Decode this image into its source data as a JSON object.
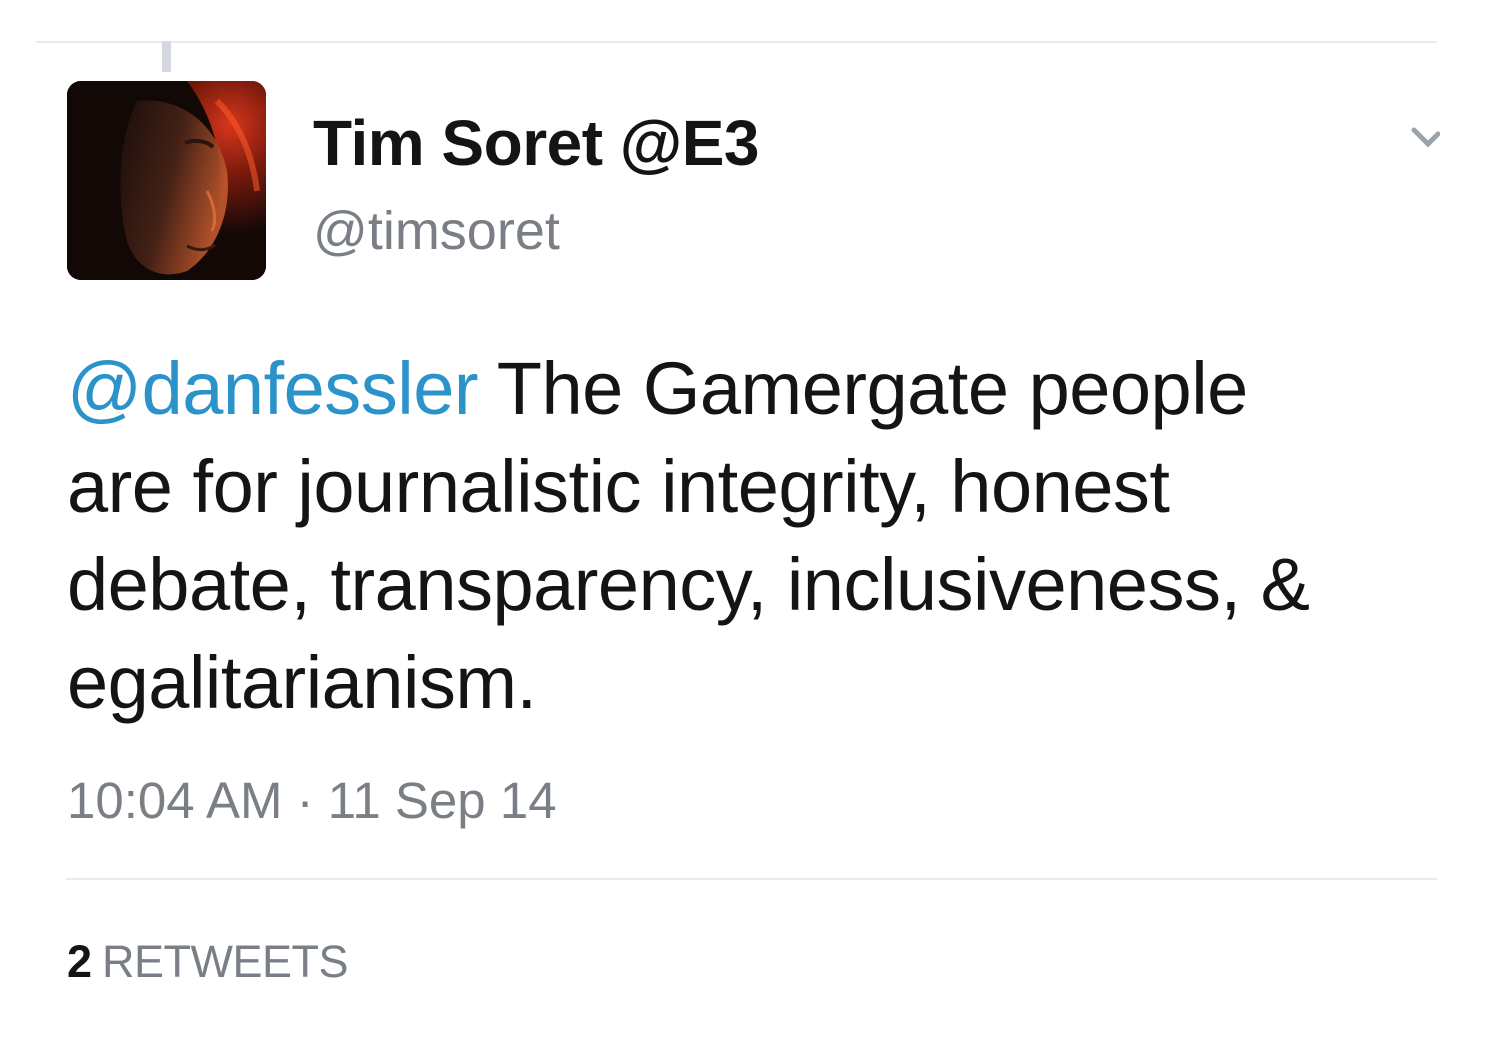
{
  "tweet": {
    "author": {
      "display_name": "Tim Soret @E3",
      "handle": "@timsoret"
    },
    "text": {
      "mention": "@danfessler",
      "line1_rest": " The Gamergate people",
      "line2": "are for journalistic integrity, honest",
      "line3": "debate, transparency, inclusiveness, &",
      "line4": "egalitarianism."
    },
    "timestamp": "10:04 AM · 11 Sep 14",
    "stats": {
      "retweet_count": "2",
      "retweet_label": "RETWEETS"
    }
  },
  "icons": {
    "avatar": "profile-photo",
    "menu": "chevron-down-icon"
  },
  "colors": {
    "mention": "#2b93c9",
    "secondary_text": "#7a7f85",
    "primary_text": "#141414",
    "divider": "#e6ecf0"
  }
}
